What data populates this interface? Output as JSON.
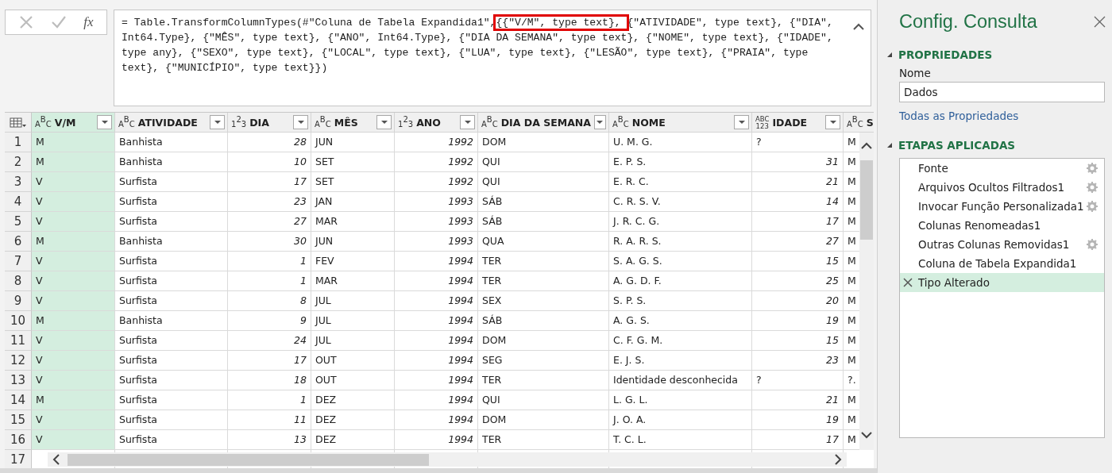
{
  "formula_bar": {
    "parts": [
      {
        "text": "= Table.TransformColumnTypes(#\"Coluna de Tabela Expandida1\",",
        "highlighted": false
      },
      {
        "text": "{{\"V/M\", type text}, ",
        "highlighted": true
      },
      {
        "text": "{\"ATIVIDADE\", type text}, {\"DIA\", Int64.Type}, {\"MÊS\", type text}, {\"ANO\", Int64.Type}, {\"DIA DA SEMANA\", type text}, {\"NOME\", type text}, {\"IDADE\", type any}, {\"SEXO\", type text}, {\"LOCAL\", type text}, {\"LUA\", type text}, {\"LESÃO\", type text}, {\"PRAIA\", type text}, {\"MUNICÍPIO\", type text}})",
        "highlighted": false
      }
    ],
    "fx_label": "fx"
  },
  "table": {
    "columns": [
      {
        "name": "V/M",
        "kind": "text",
        "type_label": "ABC",
        "selected": true
      },
      {
        "name": "ATIVIDADE",
        "kind": "text",
        "type_label": "ABC",
        "selected": false
      },
      {
        "name": "DIA",
        "kind": "number",
        "type_label": "123",
        "selected": false
      },
      {
        "name": "MÊS",
        "kind": "text",
        "type_label": "ABC",
        "selected": false
      },
      {
        "name": "ANO",
        "kind": "number",
        "type_label": "123",
        "selected": false
      },
      {
        "name": "DIA DA SEMANA",
        "kind": "text",
        "type_label": "ABC",
        "selected": false
      },
      {
        "name": "NOME",
        "kind": "text",
        "type_label": "ABC",
        "selected": false
      },
      {
        "name": "IDADE",
        "kind": "any",
        "type_label": "ABC123",
        "selected": false
      },
      {
        "name": "S",
        "kind": "text",
        "type_label": "ABC",
        "selected": false
      }
    ],
    "rows": [
      {
        "number": "1",
        "cells": [
          "M",
          "Banhista",
          "28",
          "JUN",
          "1992",
          "DOM",
          "U. M. G.",
          "?",
          "M"
        ]
      },
      {
        "number": "2",
        "cells": [
          "M",
          "Banhista",
          "10",
          "SET",
          "1992",
          "QUI",
          "E. P. S.",
          "31",
          "M"
        ]
      },
      {
        "number": "3",
        "cells": [
          "V",
          "Surfista",
          "17",
          "SET",
          "1992",
          "QUI",
          "E. R. C.",
          "21",
          "M"
        ]
      },
      {
        "number": "4",
        "cells": [
          "V",
          "Surfista",
          "23",
          "JAN",
          "1993",
          "SÁB",
          "C. R. S. V.",
          "14",
          "M"
        ]
      },
      {
        "number": "5",
        "cells": [
          "V",
          "Surfista",
          "27",
          "MAR",
          "1993",
          "SÁB",
          "J. R. C. G.",
          "17",
          "M"
        ]
      },
      {
        "number": "6",
        "cells": [
          "M",
          "Banhista",
          "30",
          "JUN",
          "1993",
          "QUA",
          "R. A. R. S.",
          "27",
          "M"
        ]
      },
      {
        "number": "7",
        "cells": [
          "V",
          "Surfista",
          "1",
          "FEV",
          "1994",
          "TER",
          "S. A. G. S.",
          "15",
          "M"
        ]
      },
      {
        "number": "8",
        "cells": [
          "V",
          "Surfista",
          "1",
          "MAR",
          "1994",
          "TER",
          "A. G. D. F.",
          "25",
          "M"
        ]
      },
      {
        "number": "9",
        "cells": [
          "V",
          "Surfista",
          "8",
          "JUL",
          "1994",
          "SEX",
          "S. P. S.",
          "20",
          "M"
        ]
      },
      {
        "number": "10",
        "cells": [
          "M",
          "Banhista",
          "9",
          "JUL",
          "1994",
          "SÁB",
          "A. G. S.",
          "19",
          "M"
        ]
      },
      {
        "number": "11",
        "cells": [
          "V",
          "Surfista",
          "24",
          "JUL",
          "1994",
          "DOM",
          "C. F. G. M.",
          "15",
          "M"
        ]
      },
      {
        "number": "12",
        "cells": [
          "V",
          "Surfista",
          "17",
          "OUT",
          "1994",
          "SEG",
          "E. J. S.",
          "23",
          "M"
        ]
      },
      {
        "number": "13",
        "cells": [
          "V",
          "Surfista",
          "18",
          "OUT",
          "1994",
          "TER",
          "Identidade desconhecida",
          "?",
          "?."
        ]
      },
      {
        "number": "14",
        "cells": [
          "M",
          "Surfista",
          "1",
          "DEZ",
          "1994",
          "QUI",
          "L. G. L.",
          "21",
          "M"
        ]
      },
      {
        "number": "15",
        "cells": [
          "V",
          "Surfista",
          "11",
          "DEZ",
          "1994",
          "DOM",
          "J. O. A.",
          "19",
          "M"
        ]
      },
      {
        "number": "16",
        "cells": [
          "V",
          "Surfista",
          "13",
          "DEZ",
          "1994",
          "TER",
          "T. C. L.",
          "17",
          "M"
        ]
      },
      {
        "number": "17",
        "cells": []
      }
    ]
  },
  "query_settings": {
    "title": "Config. Consulta",
    "properties": {
      "heading": "PROPRIEDADES",
      "name_label": "Nome",
      "name_value": "Dados",
      "all_properties_link": "Todas as Propriedades"
    },
    "applied_steps": {
      "heading": "ETAPAS APLICADAS",
      "steps": [
        {
          "label": "Fonte",
          "has_settings": true,
          "selected": false
        },
        {
          "label": "Arquivos Ocultos Filtrados1",
          "has_settings": true,
          "selected": false
        },
        {
          "label": "Invocar Função Personalizada1",
          "has_settings": true,
          "selected": false
        },
        {
          "label": "Colunas Renomeadas1",
          "has_settings": false,
          "selected": false
        },
        {
          "label": "Outras Colunas Removidas1",
          "has_settings": true,
          "selected": false
        },
        {
          "label": "Coluna de Tabela Expandida1",
          "has_settings": false,
          "selected": false
        },
        {
          "label": "Tipo Alterado",
          "has_settings": false,
          "selected": true
        }
      ]
    }
  }
}
